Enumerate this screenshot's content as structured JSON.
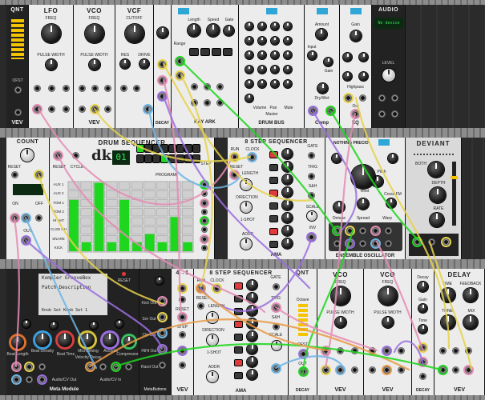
{
  "row1": {
    "qnt": {
      "title": "QNT",
      "labels": [
        "OFST",
        "INPUT",
        "OUT"
      ],
      "brand": "VEV"
    },
    "lfo": {
      "title": "LFO",
      "freq": "FREQ",
      "pw": "PULSE WIDTH",
      "brand": "VEV"
    },
    "vco": {
      "title": "VCO",
      "freq": "FREQ",
      "pw": "PULSE WIDTH",
      "brand": "VEV"
    },
    "vcf": {
      "title": "VCF",
      "cutoff": "CUTOFF",
      "res": "RES",
      "drive": "DRIVE"
    },
    "decay": {
      "label": "DECAY"
    },
    "kayark": {
      "labels": [
        "Length",
        "Speed",
        "Gate",
        "Range"
      ],
      "name": "KAY ARK"
    },
    "drumbus": {
      "labels": [
        "Volume",
        "Pan",
        "Mute",
        "Master"
      ],
      "name": "DRUM BUS"
    },
    "comp": {
      "labels": [
        "Amount",
        "Input",
        "Gain",
        "Dry/Wet"
      ],
      "name": "Comp"
    },
    "eq": {
      "labels": [
        "Gain",
        "Highpass",
        "Out"
      ],
      "name": "EQ"
    },
    "audio": {
      "title": "AUDIO",
      "device": "No device",
      "level": "LEVEL"
    }
  },
  "row2": {
    "counter": {
      "title": "COUNT",
      "labels": [
        "RESET",
        "ON",
        "OFF",
        "OUT"
      ]
    },
    "drumseq": {
      "title": "DRUM SEQUENCER",
      "logo": "dk",
      "step": "01",
      "labels": [
        "RESET",
        "CYCLE",
        "PROGRAM",
        "STEP"
      ],
      "rows": [
        "AUX 1",
        "AUX 2",
        "TOM 1",
        "TOM 2",
        "HI HAT",
        "CLSD HH",
        "SNARE",
        "KICK"
      ],
      "bars": [
        3,
        1,
        4,
        2,
        3,
        2,
        1,
        4,
        2,
        3
      ]
    },
    "stepseq": {
      "title": "8 STEP SEQUENCER",
      "labels": [
        "RUN",
        "CLOCK",
        "RESET",
        "LENGTH",
        "DIRECTION",
        "1-SHOT",
        "ADDR",
        "S&H",
        "SCALE",
        "INV",
        "GATE",
        "TRIG"
      ],
      "brand": "AMA"
    },
    "ensemble": {
      "top": "NOTHING PRECIO",
      "labels": [
        "Root",
        "Detune",
        "Spread",
        "Warp",
        "Pitch",
        "Cross FM"
      ],
      "name": "ENSEMBLE OSCILLATOR"
    },
    "deviant": {
      "title": "DEVIANT",
      "labels": [
        "BOTH",
        "DEPTH",
        "RATE",
        "IN",
        "OUT"
      ]
    }
  },
  "row3": {
    "meta": {
      "screen_title": "Kompler GrooveBox",
      "screen_sub": "Patch Description",
      "screen_line": "Knob Set  Knob Set 1",
      "labels": [
        "Beat Length",
        "Beat Density",
        "Beat Time",
        "Microtiming",
        "Velocity Decay",
        "Accents",
        "Compressor"
      ],
      "name": "Meta Module",
      "out": "Audio/CV Out",
      "in": "Audio/CV In",
      "reset": "RESET"
    },
    "metabuttons": {
      "labels": [
        "Kick Out",
        "Snr Out",
        "Clp Out",
        "HiHt Out",
        "Rand Out"
      ],
      "name": "MetaButtons"
    },
    "fourone": {
      "title": "4→1",
      "labels": [
        "RESET",
        "STEP"
      ],
      "brand": "VEV"
    },
    "stepseq2": {
      "title": "8 STEP SEQUENCER",
      "labels": [
        "RUN",
        "CLOCK",
        "RESET",
        "LENGTH",
        "DIRECTION",
        "1-SHOT",
        "ADDR",
        "S&H",
        "SCALE",
        "GATE",
        "TRIG"
      ],
      "brand": "AMA"
    },
    "qnt2": {
      "title": "QNT",
      "labels": [
        "Octave",
        "OFST",
        "OUT"
      ],
      "brand": "DECAY"
    },
    "vco_a": {
      "title": "VCO",
      "freq": "FREQ",
      "pw": "PULSE WIDTH",
      "brand": "VEV"
    },
    "vco_b": {
      "title": "VCO",
      "freq": "FREQ",
      "pw": "PULSE WIDTH",
      "brand": "VEV"
    },
    "decay2": {
      "labels": [
        "Decay",
        "Gain",
        "Tone"
      ],
      "name": "DECAY"
    },
    "delay": {
      "title": "DELAY",
      "labels": [
        "TIME",
        "FEEDBACK",
        "TONE",
        "MIX"
      ],
      "brand": "VEV"
    }
  },
  "colors": {
    "rack": "#2a2a2a",
    "green": "#1ed61e",
    "cable_pink": "#e58cb4",
    "cable_yellow": "#e7d34b",
    "cable_blue": "#6fb4e3",
    "cable_purple": "#9b6fe0",
    "cable_orange": "#e99a45"
  }
}
